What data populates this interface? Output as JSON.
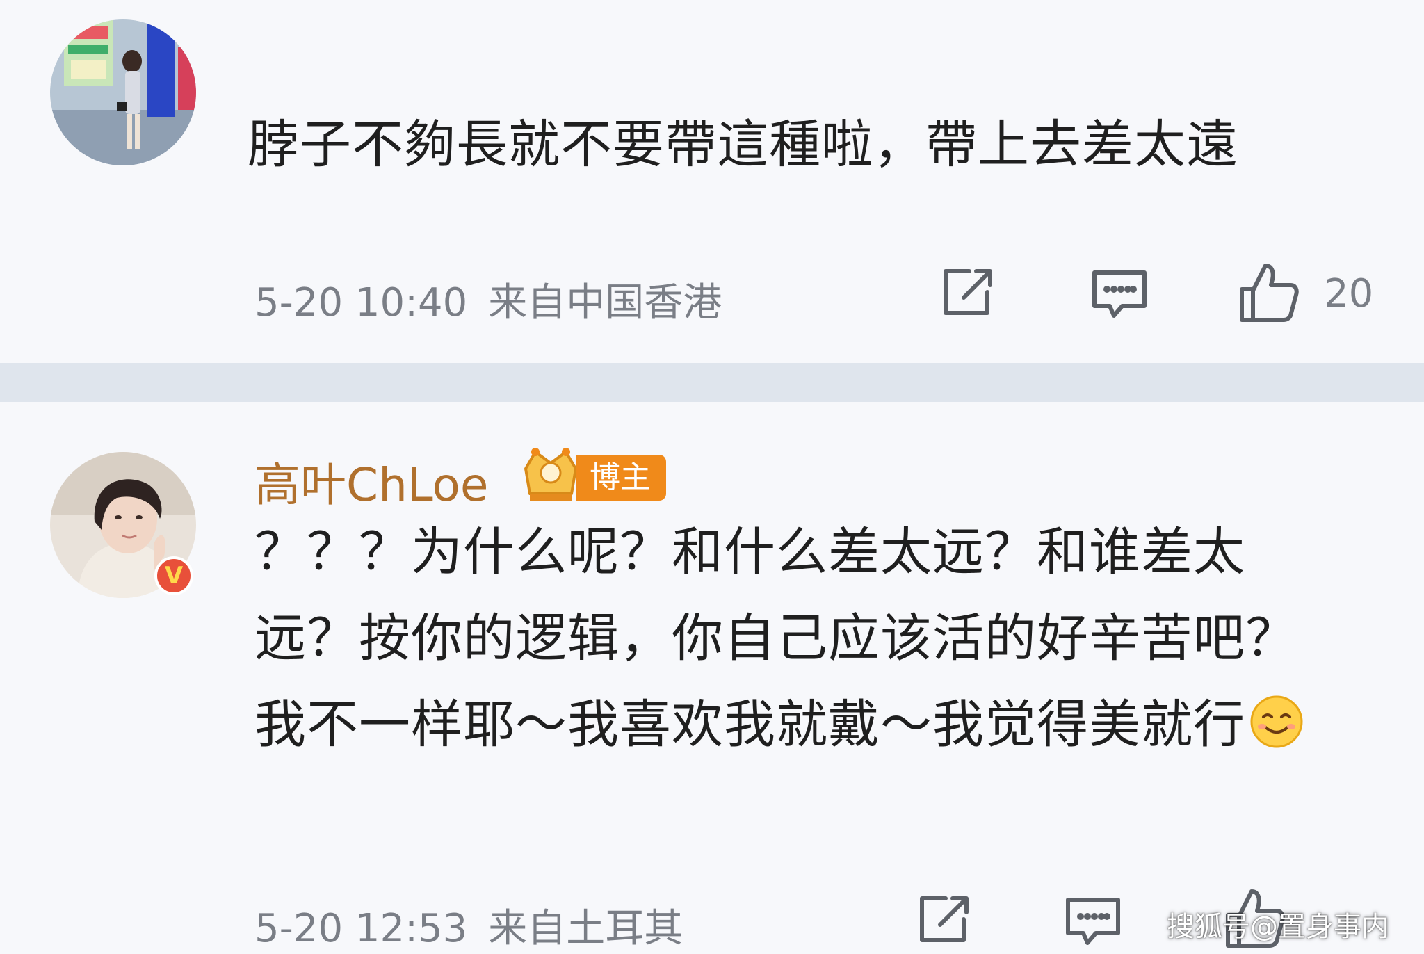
{
  "icons": {
    "repost": "repost-icon",
    "comment": "comment-icon",
    "like": "thumbs-up-icon",
    "verified": "verified-v-icon",
    "crown": "crown-icon",
    "emoji": "smile-emoji-icon"
  },
  "colors": {
    "username": "#b0702d",
    "badge_bg": "#f08a1a",
    "verified_badge": "#e8503a",
    "meta_text": "#7a7e86"
  },
  "comments": [
    {
      "text": "脖子不夠長就不要帶這種啦，帶上去差太遠",
      "time": "5-20 10:40",
      "source": "来自中国香港",
      "likes": "20"
    },
    {
      "username": "高叶ChLoe",
      "role_badge": "博主",
      "verified_badge": "V",
      "text": "？？？为什么呢？和什么差太远？和谁差太远？按你的逻辑，你自己应该活的好辛苦吧？我不一样耶～我喜欢我就戴～我觉得美就行",
      "time": "5-20 12:53",
      "source": "来自土耳其"
    }
  ],
  "watermark": "搜狐号@置身事内"
}
